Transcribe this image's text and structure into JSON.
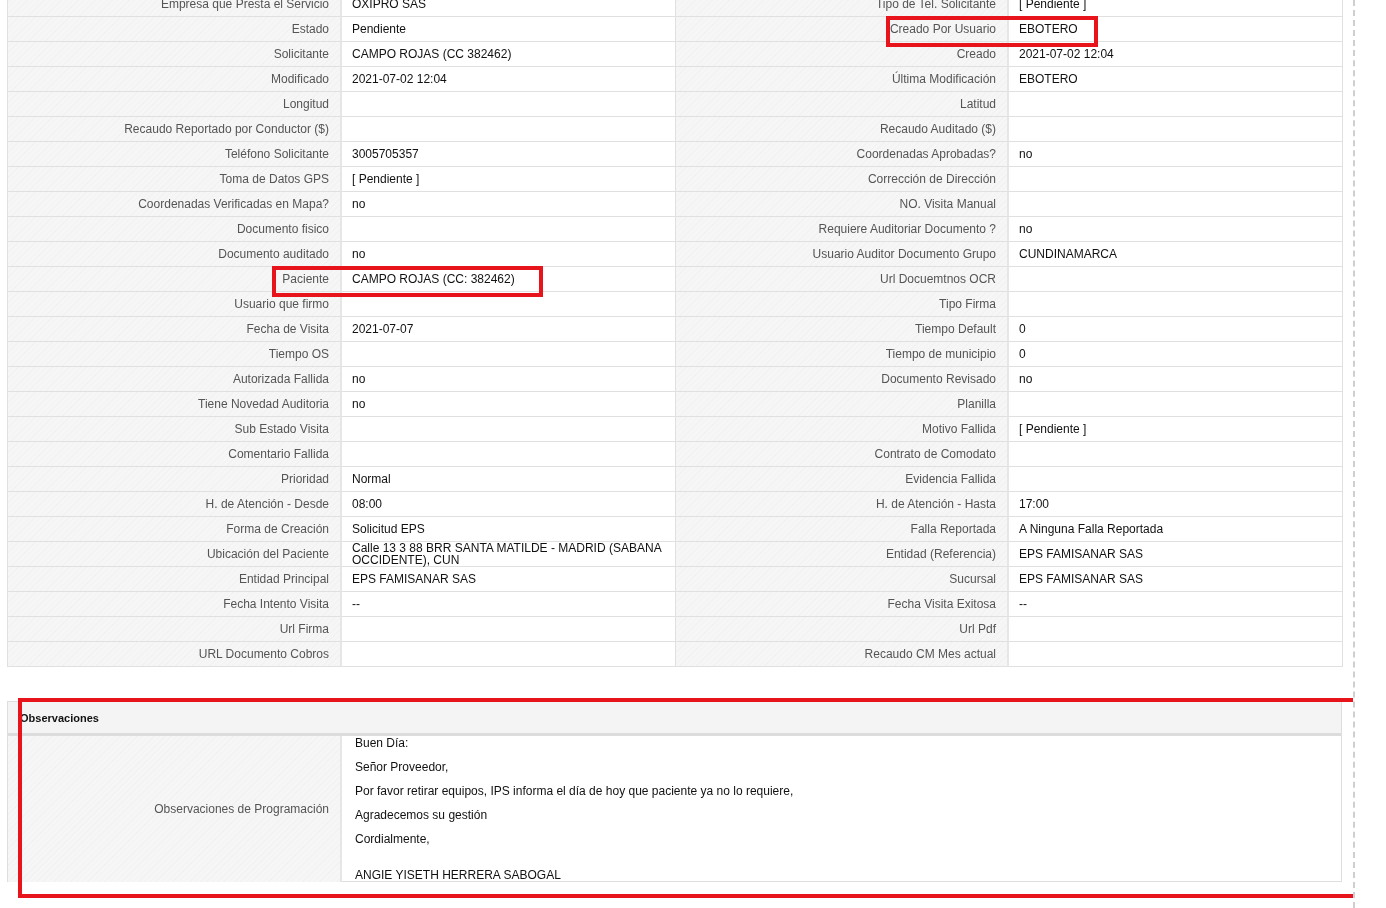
{
  "details": {
    "rows": [
      {
        "left": {
          "label": "Empresa que Presta el Servicio",
          "value": "OXIPRO SAS",
          "highlighted": false
        },
        "right": {
          "label": "Tipo de Tel. Solicitante",
          "value": "[ Pendiente ]",
          "highlighted": false
        }
      },
      {
        "left": {
          "label": "Estado",
          "value": "Pendiente",
          "highlighted": false
        },
        "right": {
          "label": "Creado Por Usuario",
          "value": "EBOTERO",
          "highlighted": true
        }
      },
      {
        "left": {
          "label": "Solicitante",
          "value": "CAMPO ROJAS (CC 382462)",
          "highlighted": false
        },
        "right": {
          "label": "Creado",
          "value": "2021-07-02 12:04",
          "highlighted": false
        }
      },
      {
        "left": {
          "label": "Modificado",
          "value": "2021-07-02 12:04",
          "highlighted": false
        },
        "right": {
          "label": "Última Modificación",
          "value": "EBOTERO",
          "highlighted": false
        }
      },
      {
        "left": {
          "label": "Longitud",
          "highlighted": false
        },
        "right": {
          "label": "Latitud",
          "highlighted": false
        }
      },
      {
        "left": {
          "label": "Recaudo Reportado por Conductor ($)",
          "highlighted": false
        },
        "right": {
          "label": "Recaudo Auditado ($)",
          "highlighted": false
        }
      },
      {
        "left": {
          "label": "Teléfono Solicitante",
          "value": "3005705357",
          "highlighted": false
        },
        "right": {
          "label": "Coordenadas Aprobadas?",
          "value": "no",
          "highlighted": false
        }
      },
      {
        "left": {
          "label": "Toma de Datos GPS",
          "value": "[ Pendiente ]",
          "highlighted": false
        },
        "right": {
          "label": "Corrección de Dirección",
          "highlighted": false
        }
      },
      {
        "left": {
          "label": "Coordenadas Verificadas en Mapa?",
          "value": "no",
          "highlighted": false
        },
        "right": {
          "label": "NO. Visita Manual",
          "highlighted": false
        }
      },
      {
        "left": {
          "label": "Documento fisico",
          "highlighted": false
        },
        "right": {
          "label": "Requiere Auditoriar Documento ?",
          "value": "no",
          "highlighted": false
        }
      },
      {
        "left": {
          "label": "Documento auditado",
          "value": "no",
          "highlighted": false
        },
        "right": {
          "label": "Usuario Auditor Documento Grupo",
          "value": "CUNDINAMARCA",
          "highlighted": false
        }
      },
      {
        "left": {
          "label": "Paciente",
          "value": "CAMPO ROJAS (CC: 382462)",
          "highlighted": true
        },
        "right": {
          "label": "Url Docuemtnos OCR",
          "highlighted": false
        }
      },
      {
        "left": {
          "label": "Usuario que firmo",
          "highlighted": false
        },
        "right": {
          "label": "Tipo Firma",
          "highlighted": false
        }
      },
      {
        "left": {
          "label": "Fecha de Visita",
          "value": "2021-07-07",
          "highlighted": false
        },
        "right": {
          "label": "Tiempo Default",
          "value": "0",
          "highlighted": false
        }
      },
      {
        "left": {
          "label": "Tiempo OS",
          "highlighted": false
        },
        "right": {
          "label": "Tiempo de municipio",
          "value": "0",
          "highlighted": false
        }
      },
      {
        "left": {
          "label": "Autorizada Fallida",
          "value": "no",
          "highlighted": false
        },
        "right": {
          "label": "Documento Revisado",
          "value": "no",
          "highlighted": false
        }
      },
      {
        "left": {
          "label": "Tiene Novedad Auditoria",
          "value": "no",
          "highlighted": false
        },
        "right": {
          "label": "Planilla",
          "highlighted": false
        }
      },
      {
        "left": {
          "label": "Sub Estado Visita",
          "highlighted": false
        },
        "right": {
          "label": "Motivo Fallida",
          "value": "[ Pendiente ]",
          "highlighted": false
        }
      },
      {
        "left": {
          "label": "Comentario Fallida",
          "highlighted": false
        },
        "right": {
          "label": "Contrato de Comodato",
          "highlighted": false
        }
      },
      {
        "left": {
          "label": "Prioridad",
          "value": "Normal",
          "highlighted": false
        },
        "right": {
          "label": "Evidencia Fallida",
          "highlighted": false
        }
      },
      {
        "left": {
          "label": "H. de Atención - Desde",
          "value": "08:00",
          "highlighted": false
        },
        "right": {
          "label": "H. de Atención - Hasta",
          "value": "17:00",
          "highlighted": false
        }
      },
      {
        "left": {
          "label": "Forma de Creación",
          "value": "Solicitud EPS",
          "highlighted": false
        },
        "right": {
          "label": "Falla Reportada",
          "value": "A Ninguna Falla Reportada",
          "highlighted": false
        }
      },
      {
        "left": {
          "label": "Ubicación del Paciente",
          "value": "Calle 13 3 88 BRR SANTA MATILDE - MADRID (SABANA OCCIDENTE), CUN",
          "highlighted": false
        },
        "right": {
          "label": "Entidad (Referencia)",
          "value": "EPS FAMISANAR SAS",
          "highlighted": false
        }
      },
      {
        "left": {
          "label": "Entidad Principal",
          "value": "EPS FAMISANAR SAS",
          "highlighted": false
        },
        "right": {
          "label": "Sucursal",
          "value": "EPS FAMISANAR SAS",
          "highlighted": false
        }
      },
      {
        "left": {
          "label": "Fecha Intento Visita",
          "value": "--",
          "highlighted": false
        },
        "right": {
          "label": "Fecha Visita Exitosa",
          "value": "--",
          "highlighted": false
        }
      },
      {
        "left": {
          "label": "Url Firma",
          "highlighted": false
        },
        "right": {
          "label": "Url Pdf",
          "highlighted": false
        }
      },
      {
        "left": {
          "label": "URL Documento Cobros",
          "highlighted": false
        },
        "right": {
          "label": "Recaudo CM Mes actual",
          "highlighted": false
        }
      }
    ]
  },
  "observations": {
    "title": "Observaciones",
    "highlighted": true,
    "label": "Observaciones de Programación",
    "paragraphs": [
      "Buen Día:",
      "Señor Proveedor,",
      "Por favor retirar equipos, IPS informa el día de hoy que paciente ya no lo requiere,",
      "Agradecemos su gestión",
      "Cordialmente,"
    ],
    "signature": "ANGIE YISETH HERRERA SABOGAL"
  }
}
